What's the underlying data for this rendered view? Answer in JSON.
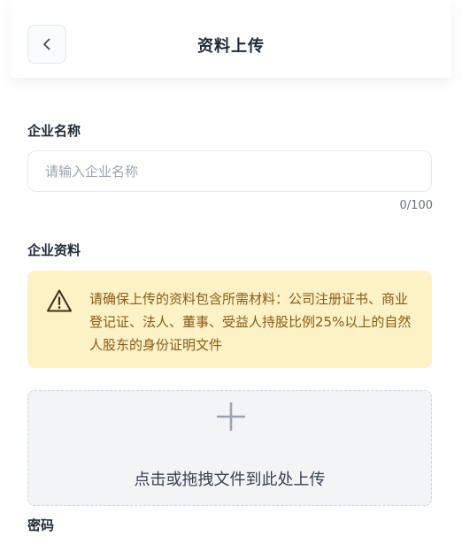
{
  "header": {
    "title": "资料上传",
    "back_icon": "chevron-left-icon"
  },
  "company_name": {
    "label": "企业名称",
    "placeholder": "请输入企业名称",
    "value": "",
    "counter": "0/100"
  },
  "company_docs": {
    "label": "企业资料",
    "notice": {
      "icon": "warning-icon",
      "text": "请确保上传的资料包含所需材料：公司注册证书、商业登记证、法人、董事、受益人持股比例25%以上的自然人股东的身份证明文件"
    },
    "upload": {
      "icon": "plus-icon",
      "text": "点击或拖拽文件到此处上传"
    }
  },
  "password": {
    "label": "密码"
  },
  "colors": {
    "notice_bg": "#fdf2c6",
    "notice_text": "#8a5a12",
    "upload_bg": "#f3f4f6"
  }
}
